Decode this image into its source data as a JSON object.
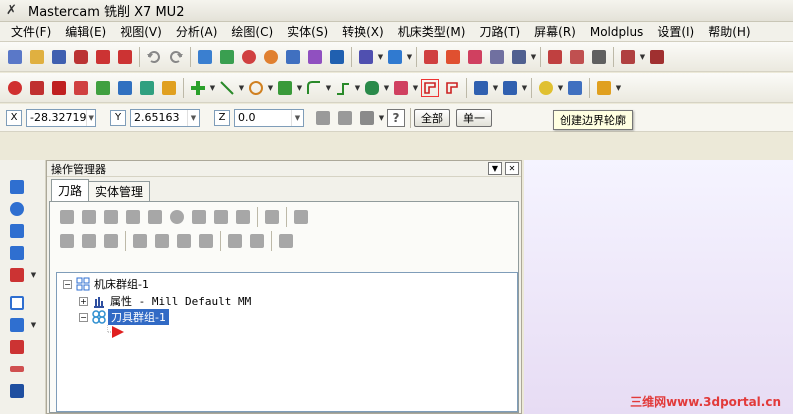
{
  "window": {
    "title": "Mastercam 铣削 X7 MU2"
  },
  "menu": [
    "文件(F)",
    "编辑(E)",
    "视图(V)",
    "分析(A)",
    "绘图(C)",
    "实体(S)",
    "转换(X)",
    "机床类型(M)",
    "刀路(T)",
    "屏幕(R)",
    "Moldplus",
    "设置(I)",
    "帮助(H)"
  ],
  "coords": {
    "x_label": "X",
    "x_value": "-28.32719",
    "y_label": "Y",
    "y_value": "2.65163",
    "z_label": "Z",
    "z_value": "0.0"
  },
  "buttons": {
    "all": "全部",
    "single": "单一"
  },
  "tooltip": "创建边界轮廓",
  "ops_manager": {
    "title": "操作管理器",
    "tabs": [
      "刀路",
      "实体管理"
    ],
    "tree": {
      "machine_group": "机床群组-1",
      "properties": "属性 - Mill Default MM",
      "toolpath_group": "刀具群组-1"
    }
  },
  "watermark": "三维网www.3dportal.cn",
  "colors": {
    "accent": "#316ac5",
    "insert_arrow": "#e02020",
    "watermark": "#e23a3a"
  }
}
